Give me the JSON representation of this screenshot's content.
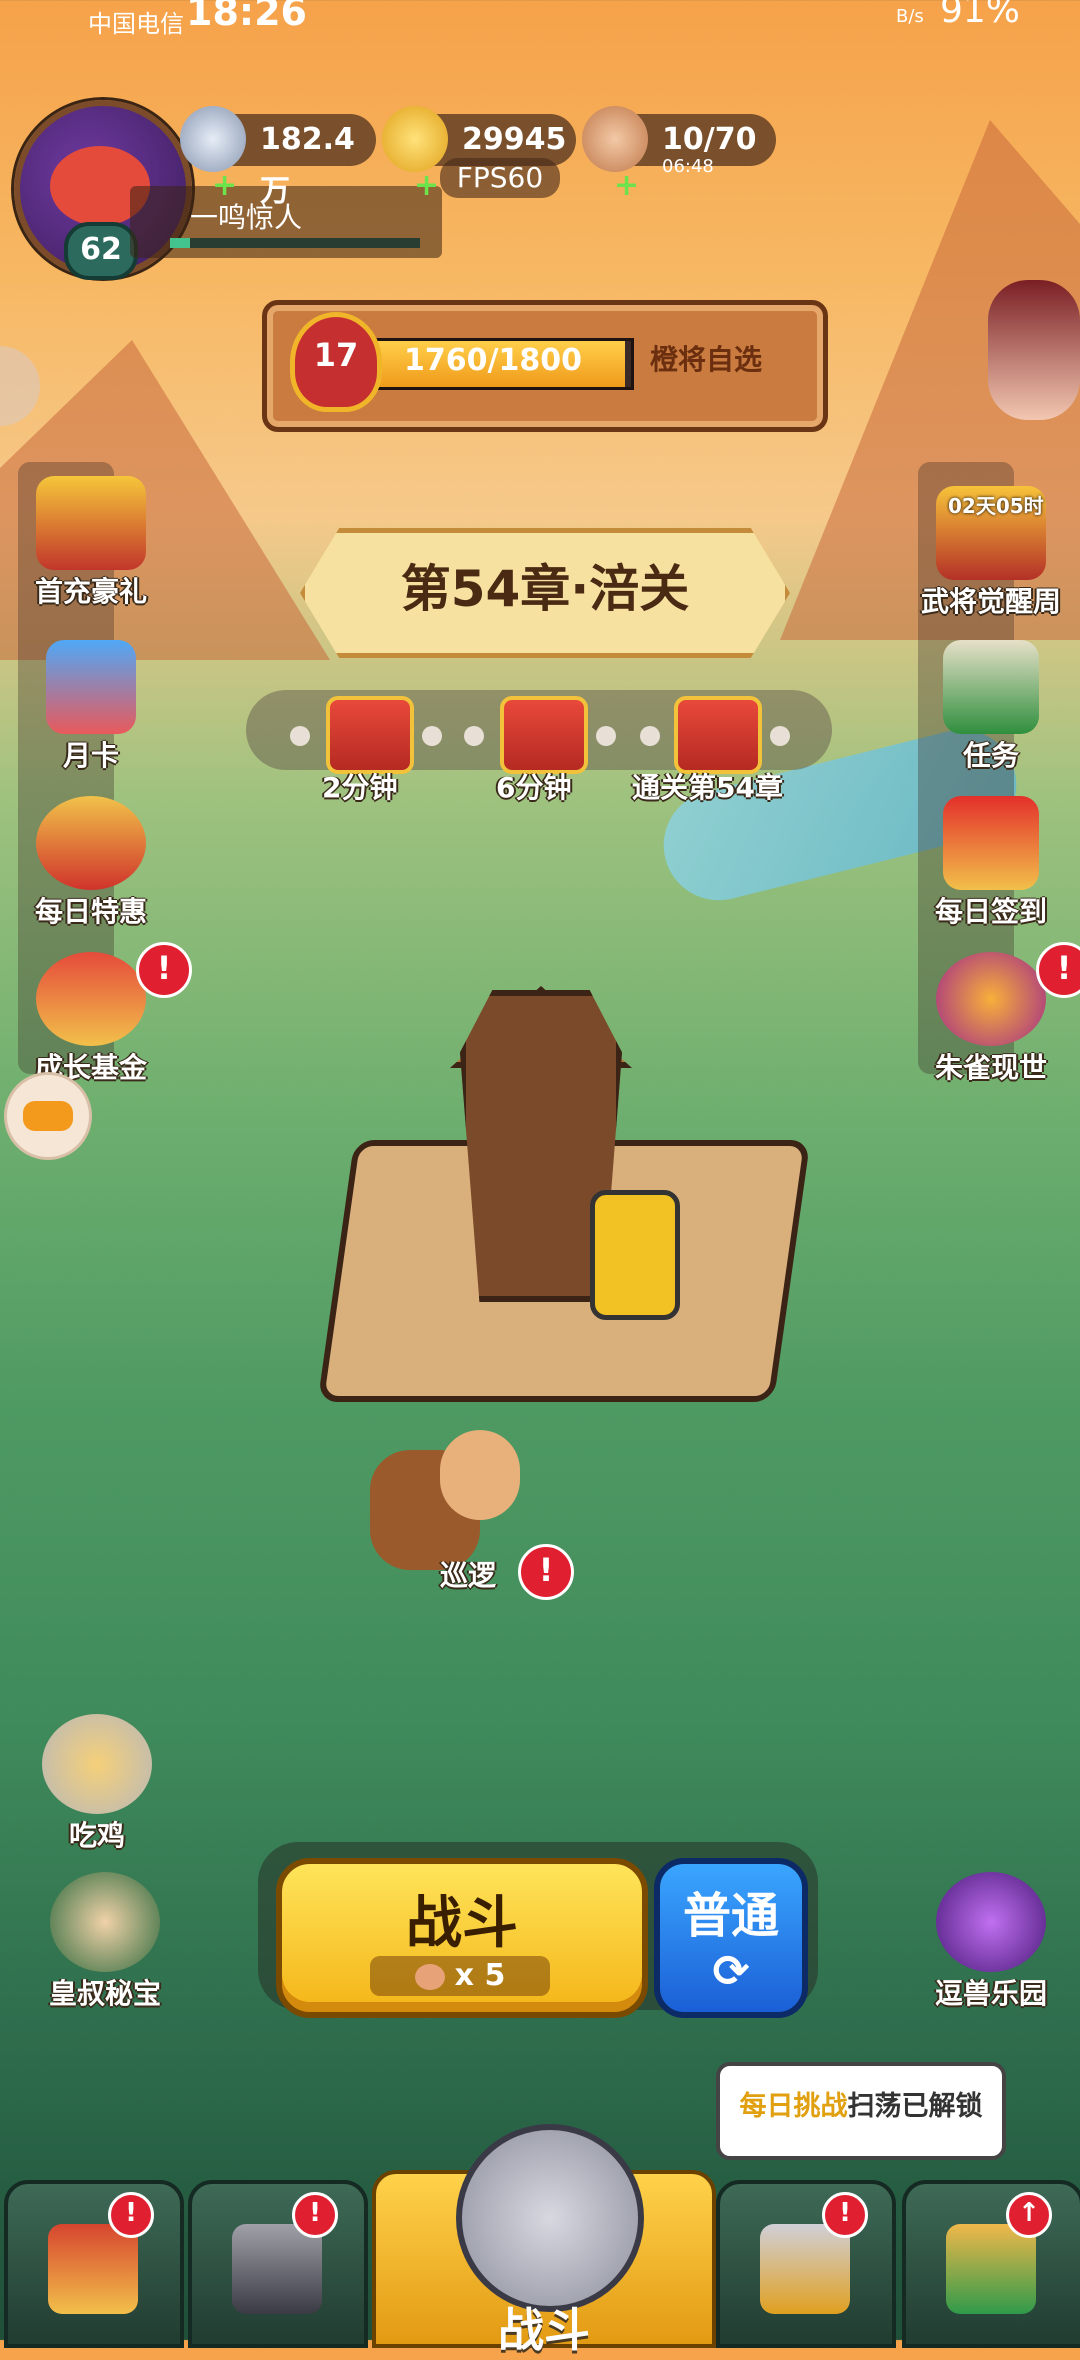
{
  "status_bar": {
    "carrier": "中国电信",
    "time": "18:26",
    "speed": "B/s",
    "battery": "91%"
  },
  "player": {
    "name": "一鸣惊人",
    "level": "62"
  },
  "resources": {
    "silver": "182.4万",
    "gold": "29945",
    "stamina": "10/70",
    "stamina_timer": "06:48",
    "fps": "FPS60"
  },
  "level_bar": {
    "level": "17",
    "progress_text": "1760/1800",
    "progress": 0.978,
    "action": "橙将自选"
  },
  "left_side": [
    {
      "label": "首充豪礼"
    },
    {
      "label": "月卡"
    },
    {
      "label": "每日特惠"
    },
    {
      "label": "成长基金",
      "badge": "!"
    }
  ],
  "right_side": [
    {
      "label": "武将觉醒周",
      "timer": "02天05时"
    },
    {
      "label": "任务"
    },
    {
      "label": "每日签到"
    },
    {
      "label": "朱雀现世",
      "badge": "!"
    }
  ],
  "chapter": {
    "title": "第54章·涪关"
  },
  "chests": [
    {
      "label": "2分钟"
    },
    {
      "label": "6分钟"
    },
    {
      "label": "通关第54章"
    }
  ],
  "patrol": {
    "label": "巡逻",
    "badge": "!"
  },
  "bottom_left": [
    {
      "label": "吃鸡"
    },
    {
      "label": "皇叔秘宝"
    }
  ],
  "bottom_right": [
    {
      "label": "逗兽乐园"
    }
  ],
  "battle": {
    "fight_label": "战斗",
    "cost": "x 5",
    "mode_label": "普通",
    "refresh_icon": "⟳"
  },
  "tip": {
    "highlight": "每日挑战",
    "rest": "扫荡已解锁"
  },
  "nav": {
    "center_label": "战斗",
    "badge": "!"
  },
  "colors": {
    "accent": "#f4b517",
    "blue_button": "#1b5fd6",
    "badge_red": "#e02030"
  }
}
